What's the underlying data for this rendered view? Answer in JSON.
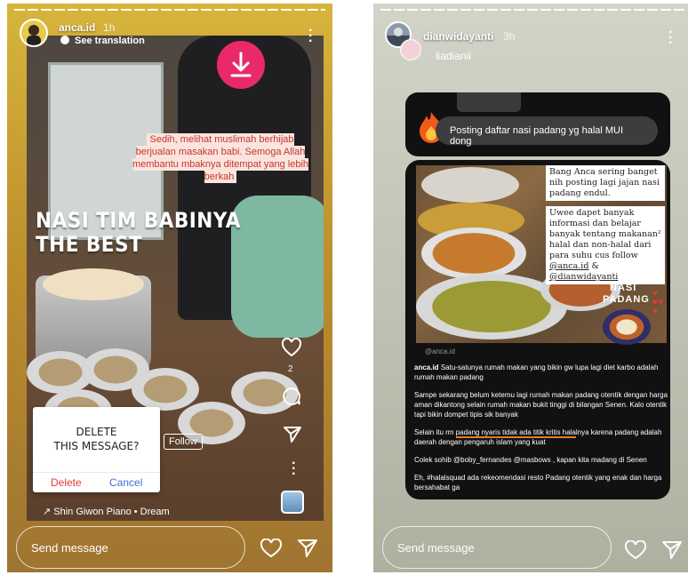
{
  "left_story": {
    "username": "anca.id",
    "time": "1h",
    "see_translation": "See translation",
    "caption": "Sedih, melihat muslimah berhijab berjualan masakan babi. Semoga Allah membantu mbaknya ditempat yang lebih berkah",
    "overlay_line1": "NASI TIM BABINYA",
    "overlay_line2": "THE BEST",
    "like_count": "2",
    "follow_label": "Follow",
    "music": "Shin Giwon Piano • Dream",
    "dialog": {
      "title_line1": "DELETE",
      "title_line2": "THIS MESSAGE?",
      "delete_label": "Delete",
      "cancel_label": "Cancel"
    },
    "send_placeholder": "Send message",
    "colors": {
      "download": "#ea2a68",
      "delete": "#e53935",
      "cancel": "#3f6fd1"
    }
  },
  "right_story": {
    "username": "dianwidayanti",
    "time": "3h",
    "reply_to": "liadianii",
    "comment": "Posting daftar nasi padang yg halal MUI dong",
    "note1": "Bang Anca sering banget nih posting lagi jajan nasi padang endul.",
    "note2": "Uwee dapet banyak informasi dan belajar banyak tentang makanan² halal dan non-halal dari para suhu cus follow",
    "note2_handle1": "@anca.id",
    "note2_amp": "&",
    "note2_handle2": "@dianwidayanti",
    "sticker_line1": "NASI",
    "sticker_line2": "PADANG",
    "watermark": "@anca.id",
    "post_user": "anca.id",
    "post_p1": "Satu-satunya rumah makan yang bikin gw lupa lagi diet karbo adalah rumah makan padang",
    "post_p2": "Sampe sekarang belum ketemu lagi rumah makan padang otentik dengan harga aman dikantong selain rumah makan bukit tinggi di bilangan Senen. Kalo otentik tapi bikin dompet tipis sik banyak",
    "post_p3_pre": "Selain itu rm ",
    "post_p3_underlined": "padang nyaris tidak ada titik kritis hala",
    "post_p3_post": "lnya karena padang adalah daerah dengan pengaruh islam yang kuat",
    "post_p4": "Colek sohib @boby_fernandes @masbows , kapan kita madang di Senen",
    "post_p5": "Eh, #halalsquad ada rekeomendasi resto Padang otentik yang enak dan harga bersahabat ga",
    "send_placeholder": "Send message",
    "colors": {
      "underline": "#e67e22"
    }
  }
}
